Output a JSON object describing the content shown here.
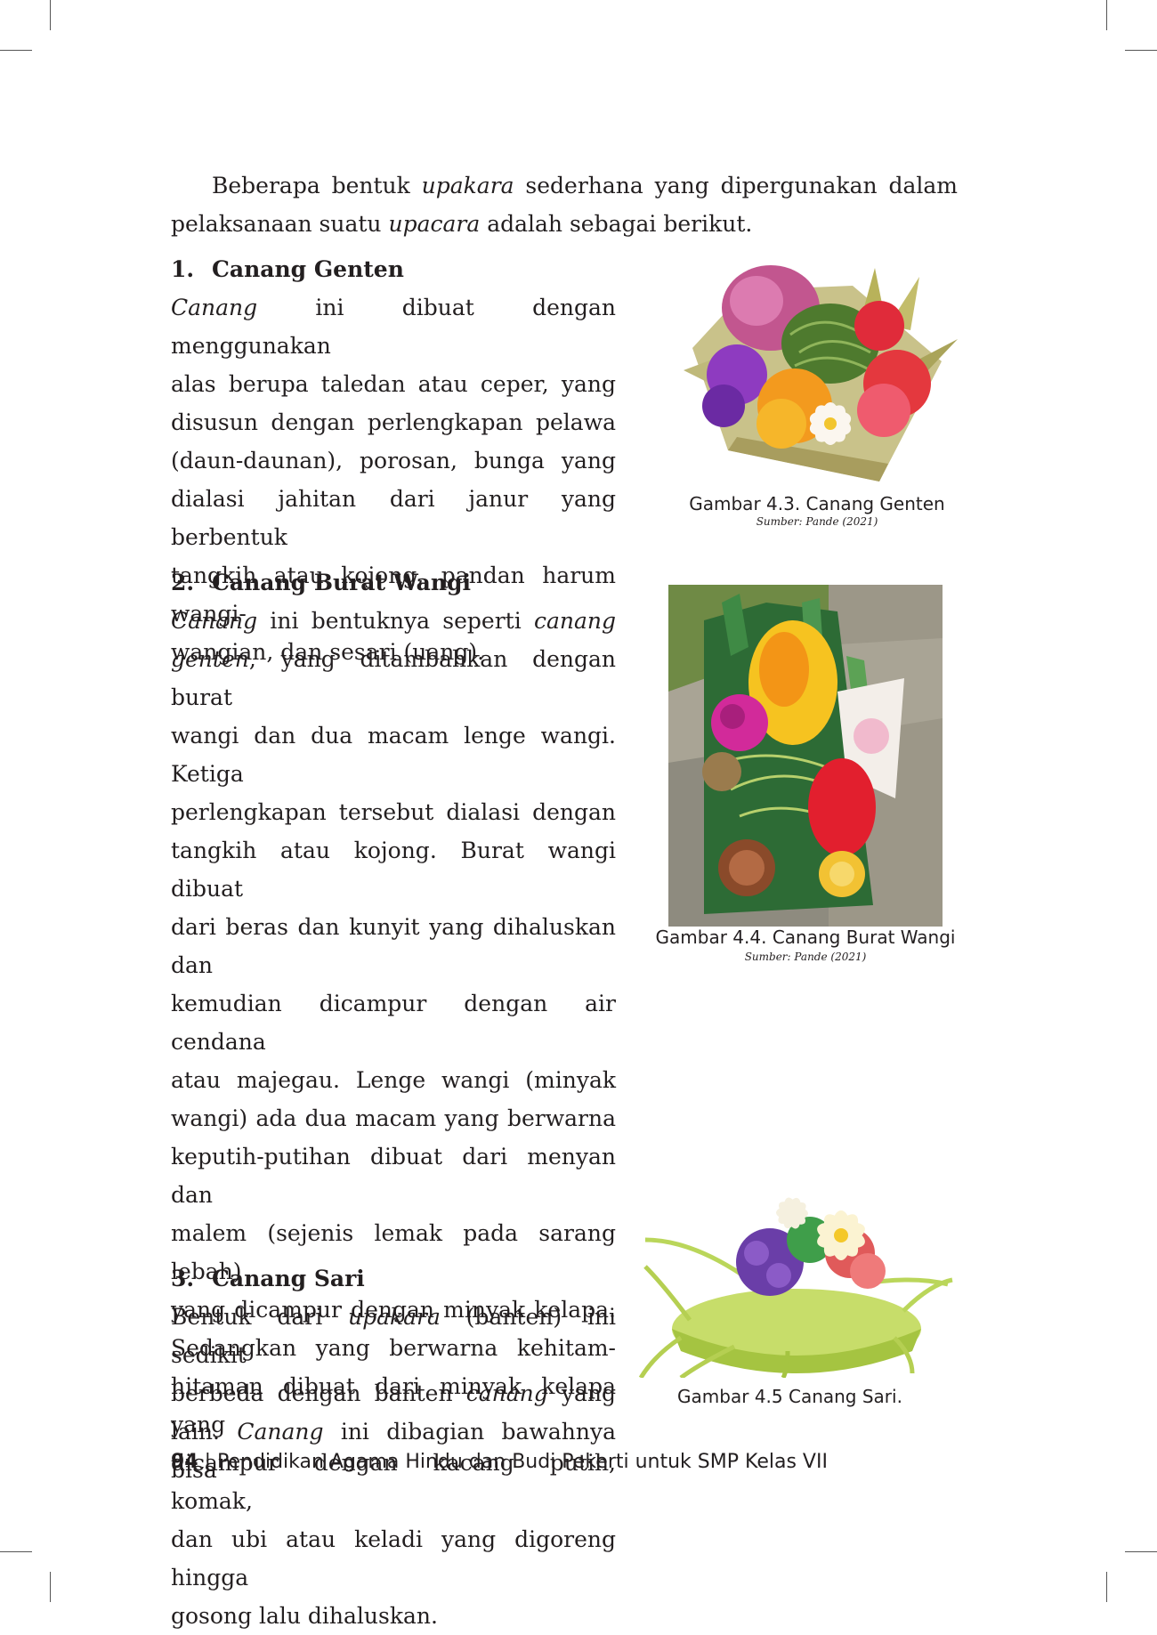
{
  "intro": {
    "line1": [
      "Beberapa bentuk ",
      "upakara",
      " sederhana yang dipergunakan dalam"
    ],
    "line2": [
      "pelaksanaan suatu ",
      "upacara",
      " adalah sebagai berikut."
    ]
  },
  "sections": [
    {
      "number": "1.",
      "title": "Canang Genten",
      "lines": [
        [
          "Canang",
          " ini dibuat dengan menggunakan"
        ],
        "alas berupa taledan atau ceper, yang",
        "disusun dengan perlengkapan pelawa",
        "(daun-daunan), porosan, bunga yang",
        "dialasi jahitan dari janur yang berbentuk",
        "tangkih atau kojong, pandan harum wangi-",
        "wangian, dan sesari (uang)."
      ]
    },
    {
      "number": "2.",
      "title": "Canang Burat Wangi",
      "lines": [
        [
          "Canang",
          " ini bentuknya seperti ",
          "canang"
        ],
        [
          "genten",
          ", yang ditambahkan dengan burat"
        ],
        "wangi dan dua macam lenge wangi. Ketiga",
        "perlengkapan tersebut dialasi dengan",
        "tangkih atau kojong. Burat wangi dibuat",
        "dari beras dan kunyit yang dihaluskan dan",
        "kemudian dicampur dengan air cendana",
        "atau majegau. Lenge wangi (minyak",
        "wangi) ada dua macam yang berwarna",
        "keputih-putihan dibuat dari menyan dan",
        "malem (sejenis lemak pada sarang lebah)",
        "yang dicampur dengan minyak kelapa.",
        "Sedangkan yang berwarna kehitam-",
        "hitaman dibuat dari minyak kelapa yang",
        "dicampur dengan kacang putih, komak,",
        "dan ubi atau keladi yang digoreng hingga",
        "gosong lalu dihaluskan."
      ]
    },
    {
      "number": "3.",
      "title": "Canang Sari",
      "lines": [
        [
          "Bentuk dari ",
          "upakara",
          " (banten) ini sedikit"
        ],
        [
          "berbeda dengan banten ",
          "canang",
          " yang"
        ],
        [
          "lain. ",
          "Canang",
          " ini dibagian bawahnya bisa"
        ]
      ]
    }
  ],
  "figures": [
    {
      "caption": "Gambar 4.3. Canang Genten",
      "source": "Sumber: Pande (2021)"
    },
    {
      "caption": "Gambar 4.4. Canang Burat Wangi",
      "source": "Sumber: Pande (2021)"
    },
    {
      "caption": "Gambar 4.5 Canang Sari."
    }
  ],
  "footer": {
    "page_number": "94",
    "separator": " | ",
    "book_title": "Pendidikan Agama Hindu dan Budi Pekerti untuk SMP Kelas VII"
  }
}
